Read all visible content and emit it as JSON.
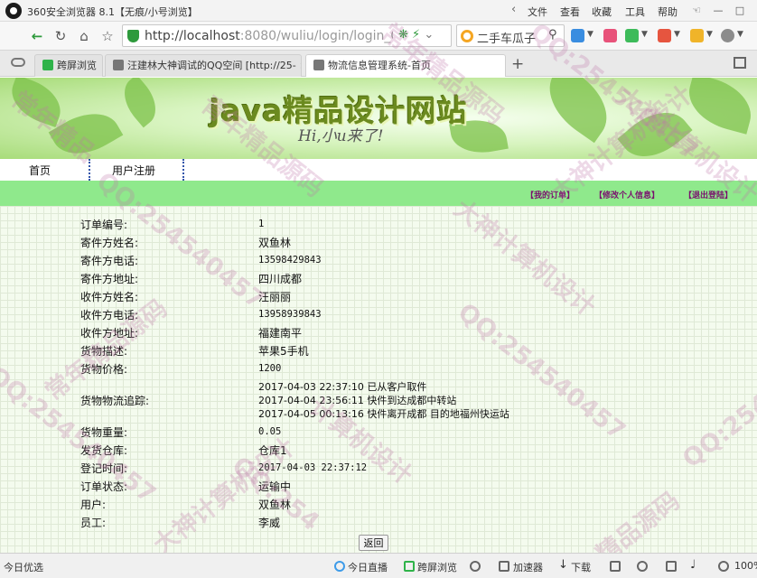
{
  "browser": {
    "window_title": "360安全浏览器 8.1【无痕/小号浏览】",
    "menu": [
      "文件",
      "查看",
      "收藏",
      "工具",
      "帮助"
    ],
    "url_host": "http://localhost",
    "url_rest": ":8080/wuliu/login/login_Che",
    "search_text": "二手车瓜子",
    "tabs": [
      {
        "label": "跨屏浏览"
      },
      {
        "label": "汪建林大神调试的QQ空间 [http://25- ×"
      },
      {
        "label": "物流信息管理系统-首页"
      }
    ]
  },
  "site": {
    "banner_title": "java精品设计网站",
    "banner_subtitle": "Hi,小u来了!",
    "nav": [
      "首页",
      "用户注册"
    ],
    "toolbar_links": [
      "【我的订单】",
      "【修改个人信息】",
      "【退出登陆】"
    ]
  },
  "order": {
    "fields": [
      {
        "label": "订单编号:",
        "value": "1"
      },
      {
        "label": "寄件方姓名:",
        "value": "双鱼林"
      },
      {
        "label": "寄件方电话:",
        "value": "13598429843"
      },
      {
        "label": "寄件方地址:",
        "value": "四川成都"
      },
      {
        "label": "收件方姓名:",
        "value": "汪丽丽"
      },
      {
        "label": "收件方电话:",
        "value": "13958939843"
      },
      {
        "label": "收件方地址:",
        "value": "福建南平"
      },
      {
        "label": "货物描述:",
        "value": "苹果5手机"
      },
      {
        "label": "货物价格:",
        "value": "1200"
      }
    ],
    "tracking_label": "货物物流追踪:",
    "tracking": [
      "2017-04-03 22:37:10 已从客户取件",
      "2017-04-04 23:56:11 快件到达成都中转站",
      "2017-04-05 00:13:16 快件离开成都 目的地福州快运站"
    ],
    "fields2": [
      {
        "label": "货物重量:",
        "value": "0.05"
      },
      {
        "label": "发货仓库:",
        "value": "仓库1"
      },
      {
        "label": "登记时间:",
        "value": "2017-04-03 22:37:12"
      },
      {
        "label": "订单状态:",
        "value": "运输中"
      },
      {
        "label": "用户:",
        "value": "双鱼林"
      },
      {
        "label": "员工:",
        "value": "李威"
      }
    ],
    "back_label": "返回"
  },
  "watermarks": [
    "QQ:254540457",
    "大神计算机设计",
    "常年精品源码",
    "QQ:2543",
    "青年精品源码",
    "大神计算机设计",
    "QQ:254540457",
    "常年精品",
    "QQ:254540457",
    "大神计算机设计",
    "计算机设计",
    "常年精品源码",
    "QQ:254540457",
    "大神计算机设计",
    "精品源码",
    "QQ:254"
  ],
  "statusbar": {
    "left": "今日优选",
    "items": [
      "今日直播",
      "跨屏浏览",
      "加速器",
      "下载",
      "100%"
    ]
  }
}
